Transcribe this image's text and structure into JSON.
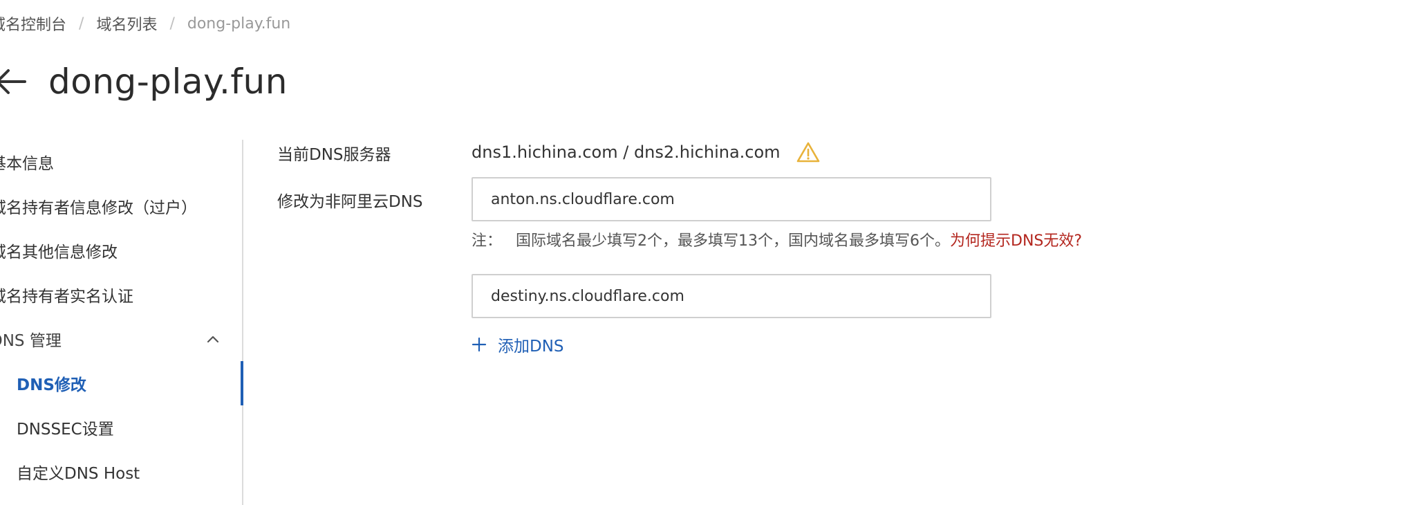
{
  "breadcrumb": {
    "items": [
      "域名控制台",
      "域名列表",
      "dong-play.fun"
    ],
    "separator": "/"
  },
  "header": {
    "back_icon": "arrow-left-icon",
    "title": "dong-play.fun"
  },
  "sidebar": {
    "items": [
      {
        "label": "基本信息"
      },
      {
        "label": "域名持有者信息修改（过户）"
      },
      {
        "label": "域名其他信息修改"
      },
      {
        "label": "域名持有者实名认证"
      }
    ],
    "group": {
      "label": "DNS 管理",
      "icon": "chevron-up-icon",
      "expanded": true,
      "children": [
        {
          "label": "DNS修改",
          "active": true
        },
        {
          "label": "DNSSEC设置",
          "active": false
        },
        {
          "label": "自定义DNS Host",
          "active": false
        }
      ]
    }
  },
  "form": {
    "current_dns_label": "当前DNS服务器",
    "current_dns_value": "dns1.hichina.com / dns2.hichina.com",
    "warning_icon": "warning-triangle-icon",
    "modify_label": "修改为非阿里云DNS",
    "dns_inputs": [
      {
        "value": "anton.ns.cloudflare.com"
      },
      {
        "value": "destiny.ns.cloudflare.com"
      }
    ],
    "note_label": "注：",
    "note_text": "国际域名最少填写2个，最多填写13个，国内域名最多填写6个。",
    "note_link": "为何提示DNS无效?",
    "add_dns_label": "添加DNS",
    "add_icon": "plus-icon"
  },
  "colors": {
    "accent": "#1f5fb5",
    "link_red": "#b3261e",
    "warning": "#e8b23a",
    "border": "#cfcfcf"
  }
}
